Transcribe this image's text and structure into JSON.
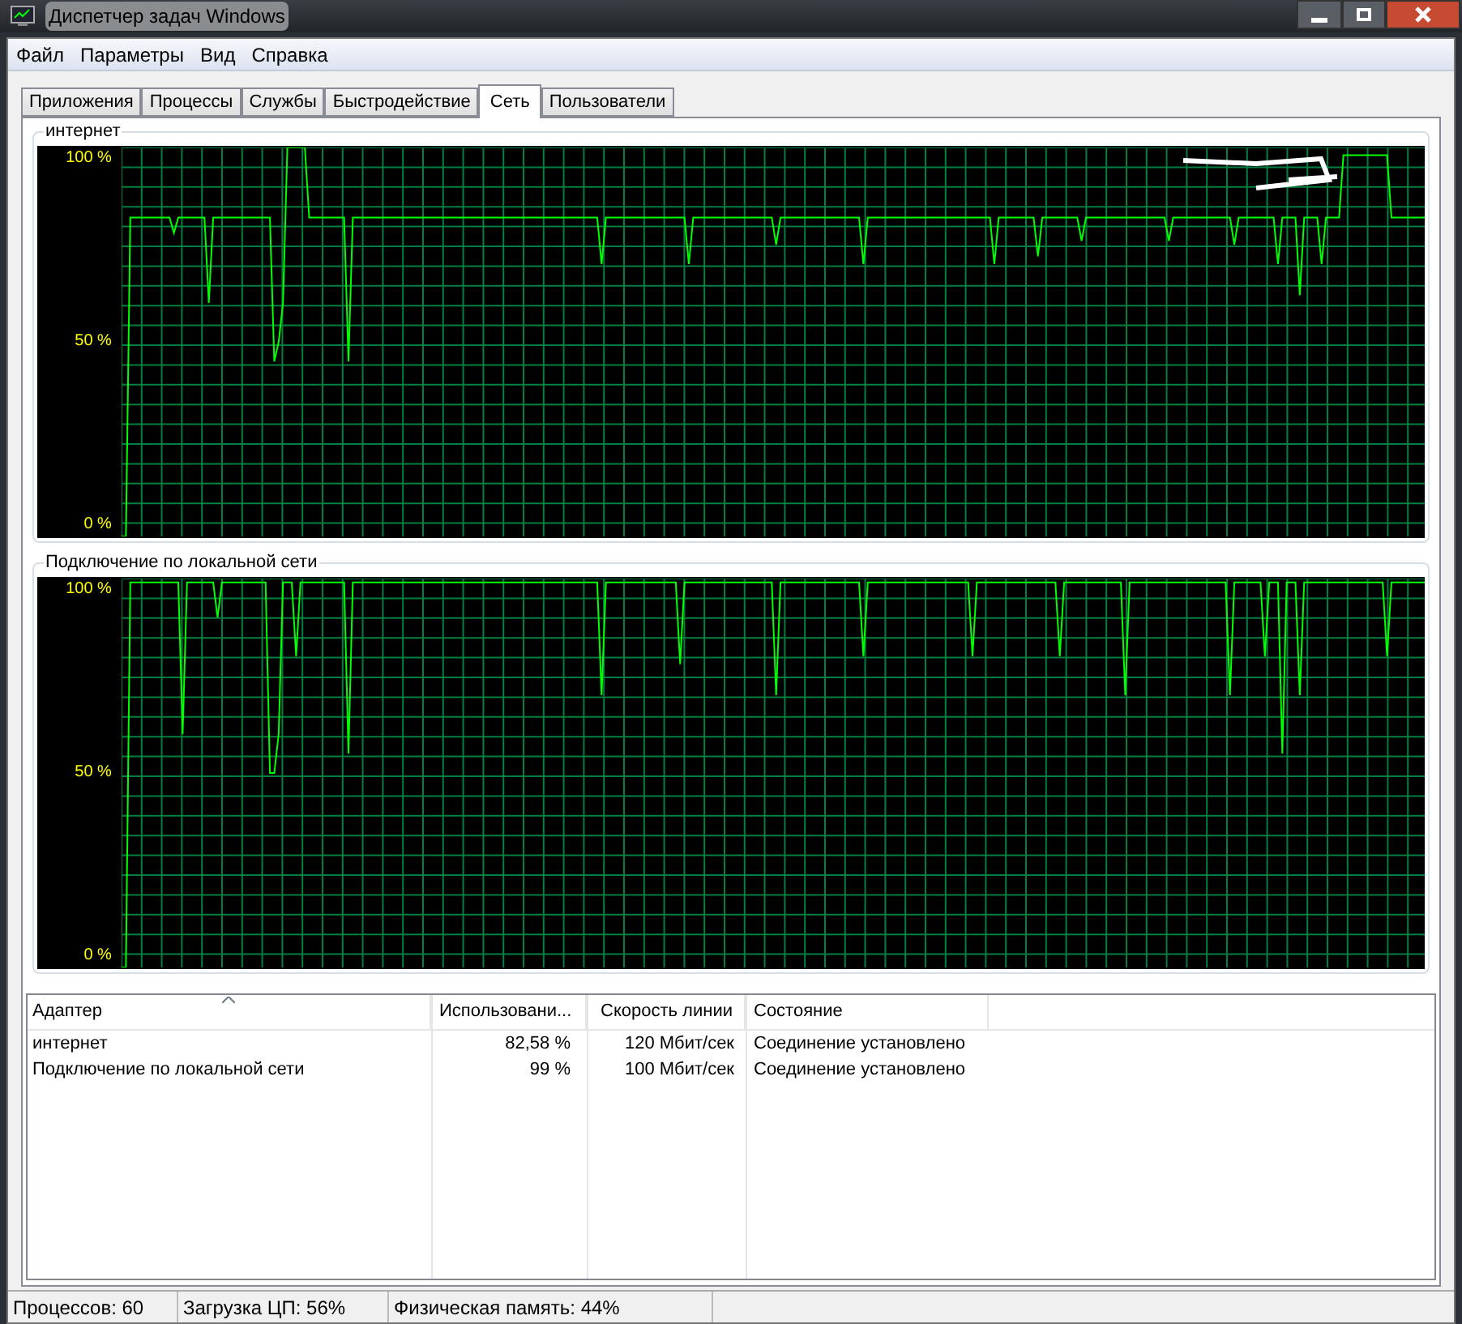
{
  "window": {
    "title": "Диспетчер задач Windows"
  },
  "menu": [
    "Файл",
    "Параметры",
    "Вид",
    "Справка"
  ],
  "tabs": [
    {
      "label": "Приложения",
      "selected": false
    },
    {
      "label": "Процессы",
      "selected": false
    },
    {
      "label": "Службы",
      "selected": false
    },
    {
      "label": "Быстродействие",
      "selected": false
    },
    {
      "label": "Сеть",
      "selected": true
    },
    {
      "label": "Пользователи",
      "selected": false
    }
  ],
  "graphs": [
    {
      "title": "интернет",
      "axis_labels": [
        "100 %",
        "50 %",
        "0 %"
      ],
      "kind": "internet"
    },
    {
      "title": "Подключение по локальной сети",
      "axis_labels": [
        "100 %",
        "50 %",
        "0 %"
      ],
      "kind": "local"
    }
  ],
  "table": {
    "columns": [
      "Адаптер",
      "Использовани...",
      "Скорость линии",
      "Состояние"
    ],
    "rows": [
      [
        "интернет",
        "82,58 %",
        "120 Мбит/сек",
        "Соединение установлено"
      ],
      [
        "Подключение по локальной сети",
        "99 %",
        "100 Мбит/сек",
        "Соединение установлено"
      ]
    ]
  },
  "status_bar": [
    "Процессов: 60",
    "Загрузка ЦП: 56%",
    "Физическая память: 44%"
  ]
}
